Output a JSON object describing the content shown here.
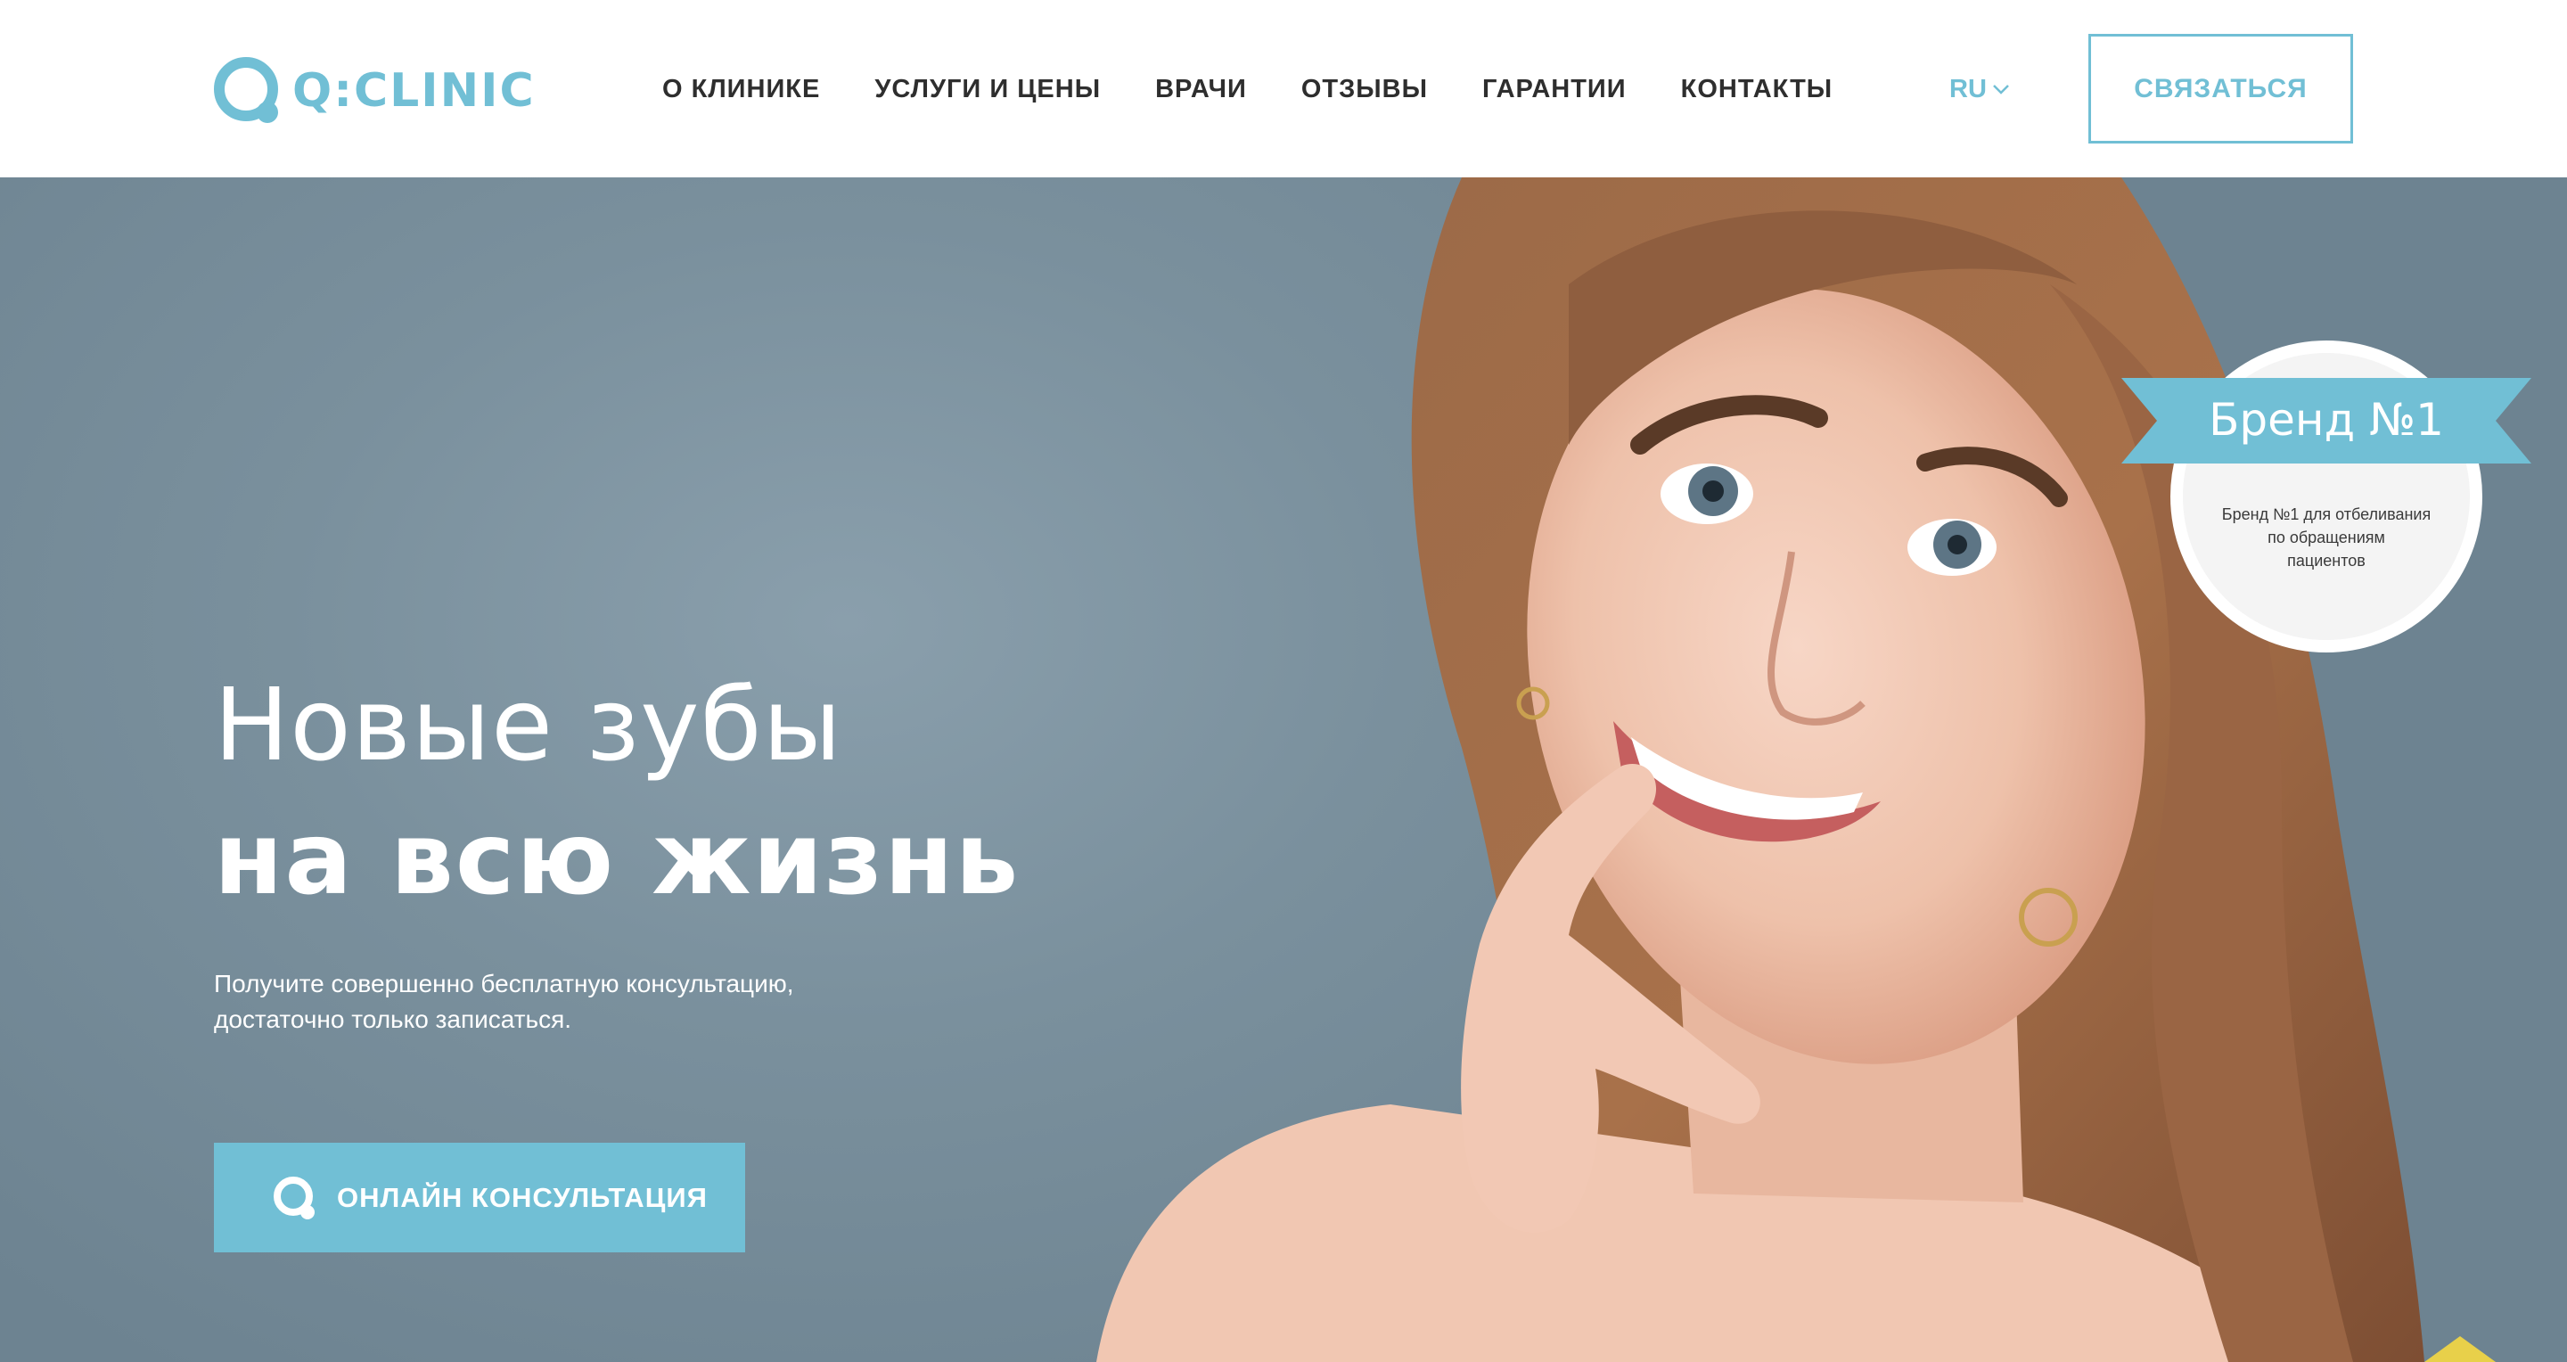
{
  "header": {
    "logo_text": "Q:CLINIC",
    "nav": [
      {
        "label": "О КЛИНИКЕ"
      },
      {
        "label": "УСЛУГИ И ЦЕНЫ"
      },
      {
        "label": "ВРАЧИ"
      },
      {
        "label": "ОТЗЫВЫ"
      },
      {
        "label": "ГАРАНТИИ"
      },
      {
        "label": "КОНТАКТЫ"
      }
    ],
    "lang": "RU",
    "contact_button": "СВЯЗАТЬСЯ"
  },
  "hero": {
    "title_line1": "Новые зубы",
    "title_line2": "на всю жизнь",
    "subtitle_line1": "Получите совершенно бесплатную консультацию,",
    "subtitle_line2": "достаточно только записаться.",
    "cta_label": "ОНЛАЙН КОНСУЛЬТАЦИЯ"
  },
  "badge": {
    "title": "Бренд №1",
    "desc_line1": "Бренд №1 для отбеливания",
    "desc_line2": "по обращениям",
    "desc_line3": "пациентов"
  },
  "colors": {
    "accent": "#71bfd5",
    "nav_text": "#2e2e2e",
    "hero_bg": "#7a909d"
  }
}
